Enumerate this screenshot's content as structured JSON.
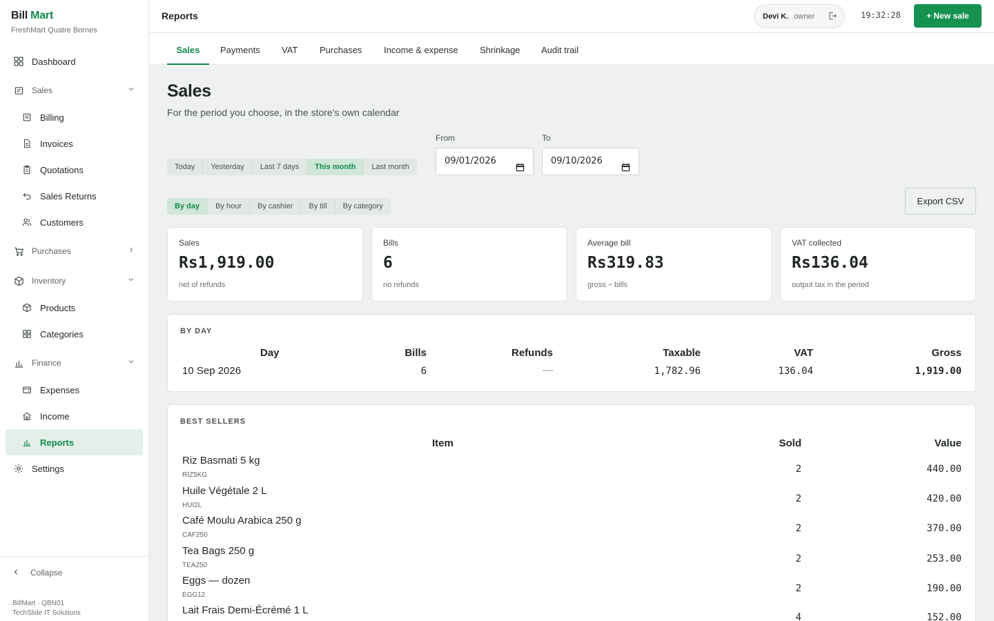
{
  "brand": {
    "name_a": "Bill",
    "name_b": "Mart",
    "store": "FreshMart Quatre Bornes"
  },
  "sidebar": {
    "dashboard": "Dashboard",
    "sales": "Sales",
    "billing": "Billing",
    "invoices": "Invoices",
    "quotations": "Quotations",
    "sales_returns": "Sales Returns",
    "customers": "Customers",
    "purchases": "Purchases",
    "inventory": "Inventory",
    "products": "Products",
    "categories": "Categories",
    "finance": "Finance",
    "expenses": "Expenses",
    "income": "Income",
    "reports": "Reports",
    "settings": "Settings",
    "collapse": "Collapse",
    "footer_line1": "BillMart · QBN01",
    "footer_line2": "TechSlide IT Solutions"
  },
  "topbar": {
    "title": "Reports",
    "user_name": "Devi K.",
    "user_role": "owner",
    "clock": "19:32:28",
    "new_sale": "+ New sale"
  },
  "tabs": [
    "Sales",
    "Payments",
    "VAT",
    "Purchases",
    "Income & expense",
    "Shrinkage",
    "Audit trail"
  ],
  "page": {
    "title": "Sales",
    "subtitle": "For the period you choose, in the store's own calendar"
  },
  "period_presets": [
    "Today",
    "Yesterday",
    "Last 7 days",
    "This month",
    "Last month"
  ],
  "period_selected": "This month",
  "dates": {
    "from_label": "From",
    "from_value": "09/01/2026",
    "to_label": "To",
    "to_value": "09/10/2026"
  },
  "groupings": [
    "By day",
    "By hour",
    "By cashier",
    "By till",
    "By category"
  ],
  "grouping_selected": "By day",
  "export_label": "Export CSV",
  "kpis": [
    {
      "label": "Sales",
      "value": "Rs1,919.00",
      "note": "net of refunds"
    },
    {
      "label": "Bills",
      "value": "6",
      "note": "no refunds"
    },
    {
      "label": "Average bill",
      "value": "Rs319.83",
      "note": "gross ÷ bills"
    },
    {
      "label": "VAT collected",
      "value": "Rs136.04",
      "note": "output tax in the period"
    }
  ],
  "by_day": {
    "title": "BY DAY",
    "headers": {
      "day": "Day",
      "bills": "Bills",
      "refunds": "Refunds",
      "taxable": "Taxable",
      "vat": "VAT",
      "gross": "Gross"
    },
    "rows": [
      {
        "day": "10 Sep 2026",
        "bills": "6",
        "refunds": "—",
        "taxable": "1,782.96",
        "vat": "136.04",
        "gross": "1,919.00"
      }
    ]
  },
  "best_sellers": {
    "title": "BEST SELLERS",
    "headers": {
      "item": "Item",
      "sold": "Sold",
      "value": "Value"
    },
    "rows": [
      {
        "name": "Riz Basmati 5 kg",
        "sku": "RIZ5KG",
        "sold": "2",
        "value": "440.00"
      },
      {
        "name": "Huile Végétale 2 L",
        "sku": "HUI2L",
        "sold": "2",
        "value": "420.00"
      },
      {
        "name": "Café Moulu Arabica 250 g",
        "sku": "CAF250",
        "sold": "2",
        "value": "370.00"
      },
      {
        "name": "Tea Bags 250 g",
        "sku": "TEA250",
        "sold": "2",
        "value": "253.00"
      },
      {
        "name": "Eggs — dozen",
        "sku": "EGG12",
        "sold": "2",
        "value": "190.00"
      },
      {
        "name": "Lait Frais Demi-Écrémé 1 L",
        "sku": "",
        "sold": "4",
        "value": "152.00"
      }
    ]
  },
  "colors": {
    "accent": "#138a4e",
    "button": "#15924f",
    "background": "#eef1ef"
  }
}
